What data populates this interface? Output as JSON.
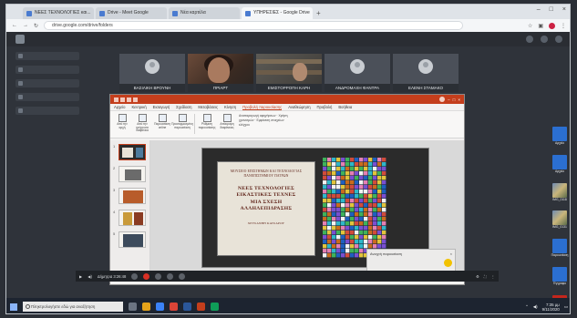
{
  "browser": {
    "tabs": [
      {
        "label": "ΝΕΕΣ ΤΕΧΝΟΛΟΓΙΕΣ και..."
      },
      {
        "label": "Drive - Meet Google"
      },
      {
        "label": "Νέα καρτέλα"
      },
      {
        "label": "ΥΠΗΡΕΣΙΕΣ - Google Drive"
      }
    ],
    "new_tab": "+",
    "url": "drive.google.com/drive/folders"
  },
  "meet": {
    "rail_items": [
      "",
      "",
      "",
      "",
      ""
    ],
    "participants": [
      {
        "name": "ΒΑΣΙΛΙΚΗ ΒΡΟΥΝΗ"
      },
      {
        "name": "ΠΡΙΑΡΤ"
      },
      {
        "name": "ΕΜΙΣΤΟΡΡΟΠΗ ΚΑΡΗ"
      },
      {
        "name": "ΑΝΔΡΟΜΑΧΗ ΦΑΝΤΡΑ"
      },
      {
        "name": "ΕΛΕΝΗ ΣΤΑΜΑΚΟ"
      }
    ],
    "controls_time": "Δήμητρα 3:26:48",
    "notif": {
      "title": "Ανοιχτή παρουσίαση",
      "line": ""
    }
  },
  "powerpoint": {
    "menu": [
      "Αρχείο",
      "Κεντρική",
      "Εισαγωγή",
      "Σχεδίαση",
      "Μεταβάσεις",
      "Κίνηση",
      "Προβολή παρουσίασης",
      "Αναθεώρηση",
      "Προβολή",
      "Βοήθεια"
    ],
    "active_menu_index": 6,
    "ribbon": [
      {
        "label": "Από την αρχή"
      },
      {
        "label": "Από την τρέχουσα διαφάνεια"
      },
      {
        "label": "Παρουσίαση online"
      },
      {
        "label": "Προσαρμοσμένη παρουσίαση"
      },
      {
        "label": "Ρύθμιση παρουσίασης"
      },
      {
        "label": "Απόκρυψη διαφάνειας"
      }
    ],
    "ribbon_options": "Αναπαραγωγή αφηγήσεων · Χρήση χρονισμών · Εμφάνιση στοιχείων ελέγχου",
    "slide_count": 5,
    "slide": {
      "institution": "ΜΟΥΣΕΙΟ ΕΠΙΣΤΗΜΩΝ ΚΑΙ ΤΕΧΝΟΛΟΓΙΑΣ ΠΑΝΕΠΙΣΤΗΜΙΟΥ ΠΑΤΡΩΝ",
      "title_lines": [
        "ΝΕΕΣ ΤΕΧΝΟΛΟΓΙΕΣ",
        "ΕΙΚΑΣΤΙΚΕΣ ΤΕΧΝΕΣ",
        "ΜΙΑ ΣΧΕΣΗ",
        "ΑΛΛΗΛΕΠΙΔΡΑΣΗΣ"
      ],
      "author": "ΧΡΥΣΑΝΘΗ ΚΑΤΣΑΡΟΥ"
    }
  },
  "desktop_icons": [
    {
      "label": "Αρχείο",
      "kind": "doc"
    },
    {
      "label": "Αρχείο",
      "kind": "doc"
    },
    {
      "label": "IMG_0118",
      "kind": "pic"
    },
    {
      "label": "IMG_0131",
      "kind": "pic"
    },
    {
      "label": "Παρουσίαση",
      "kind": "doc"
    },
    {
      "label": "Έγγραφο",
      "kind": "doc"
    },
    {
      "label": "Κεφάλαιο",
      "kind": "pdf"
    }
  ],
  "taskbar": {
    "search_placeholder": "Πληκτρολογήστε εδώ για αναζήτηση",
    "time": "7:35 μμ",
    "date": "9/11/2020"
  },
  "colors": {
    "ppt_accent": "#c43e1c",
    "meet_bg": "#2f333a",
    "taskbar": "#1d2430"
  }
}
